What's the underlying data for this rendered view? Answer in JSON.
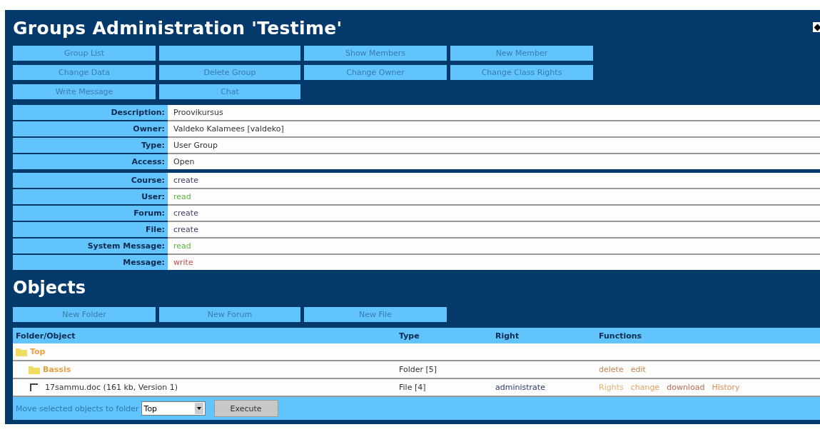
{
  "title": "Groups Administration 'Testime'",
  "menu_rows": [
    [
      {
        "kind": "button",
        "label": "Group List"
      },
      {
        "kind": "blank"
      },
      {
        "kind": "button",
        "label": "Show Members"
      },
      {
        "kind": "button",
        "label": "New Member"
      }
    ],
    [
      {
        "kind": "button",
        "label": "Change Data"
      },
      {
        "kind": "button",
        "label": "Delete Group"
      },
      {
        "kind": "button",
        "label": "Change Owner"
      },
      {
        "kind": "button",
        "label": "Change Class Rights"
      }
    ],
    [
      {
        "kind": "button",
        "label": "Write Message"
      },
      {
        "kind": "button",
        "label": "Chat"
      }
    ]
  ],
  "details": [
    {
      "label": "Description:",
      "value": "Proovikursus"
    },
    {
      "label": "Owner:",
      "value": "Valdeko Kalamees [valdeko]"
    },
    {
      "label": "Type:",
      "value": "User Group"
    },
    {
      "label": "Access:",
      "value": "Open"
    }
  ],
  "class_rights": [
    {
      "label": "Course:",
      "value": "create",
      "color": "#4a3a6a"
    },
    {
      "label": "User:",
      "value": "read",
      "color": "#5cb83c"
    },
    {
      "label": "Forum:",
      "value": "create",
      "color": "#4a3a6a"
    },
    {
      "label": "File:",
      "value": "create",
      "color": "#4a3a6a"
    },
    {
      "label": "System Message:",
      "value": "read",
      "color": "#5cb83c"
    },
    {
      "label": "Message:",
      "value": "write",
      "color": "#c0504a"
    }
  ],
  "objects": {
    "heading": "Objects",
    "buttons": [
      "New Folder",
      "New Forum",
      "New File"
    ],
    "columns": [
      "Folder/Object",
      "Type",
      "Right",
      "Functions"
    ],
    "tree": [
      {
        "kind": "folder",
        "name": "Top",
        "children": [
          {
            "kind": "folder",
            "name": "Bassis",
            "type": "Folder [5]",
            "functions": [
              {
                "label": "delete",
                "color": "#c8864e"
              },
              {
                "label": "edit",
                "color": "#c8864e"
              }
            ]
          },
          {
            "kind": "file",
            "name": "17sammu.doc (161 kb, Version 1)",
            "checked": false,
            "type": "File [4]",
            "right": "administrate",
            "functions": [
              {
                "label": "Rights",
                "color": "#e8b070"
              },
              {
                "label": "change",
                "color": "#e0a060"
              },
              {
                "label": "download",
                "color": "#b86a50"
              },
              {
                "label": "History",
                "color": "#e0905a"
              }
            ]
          }
        ]
      }
    ],
    "move": {
      "label": "Move selected objects to folder",
      "folder": "Top",
      "button": "Execute"
    }
  }
}
